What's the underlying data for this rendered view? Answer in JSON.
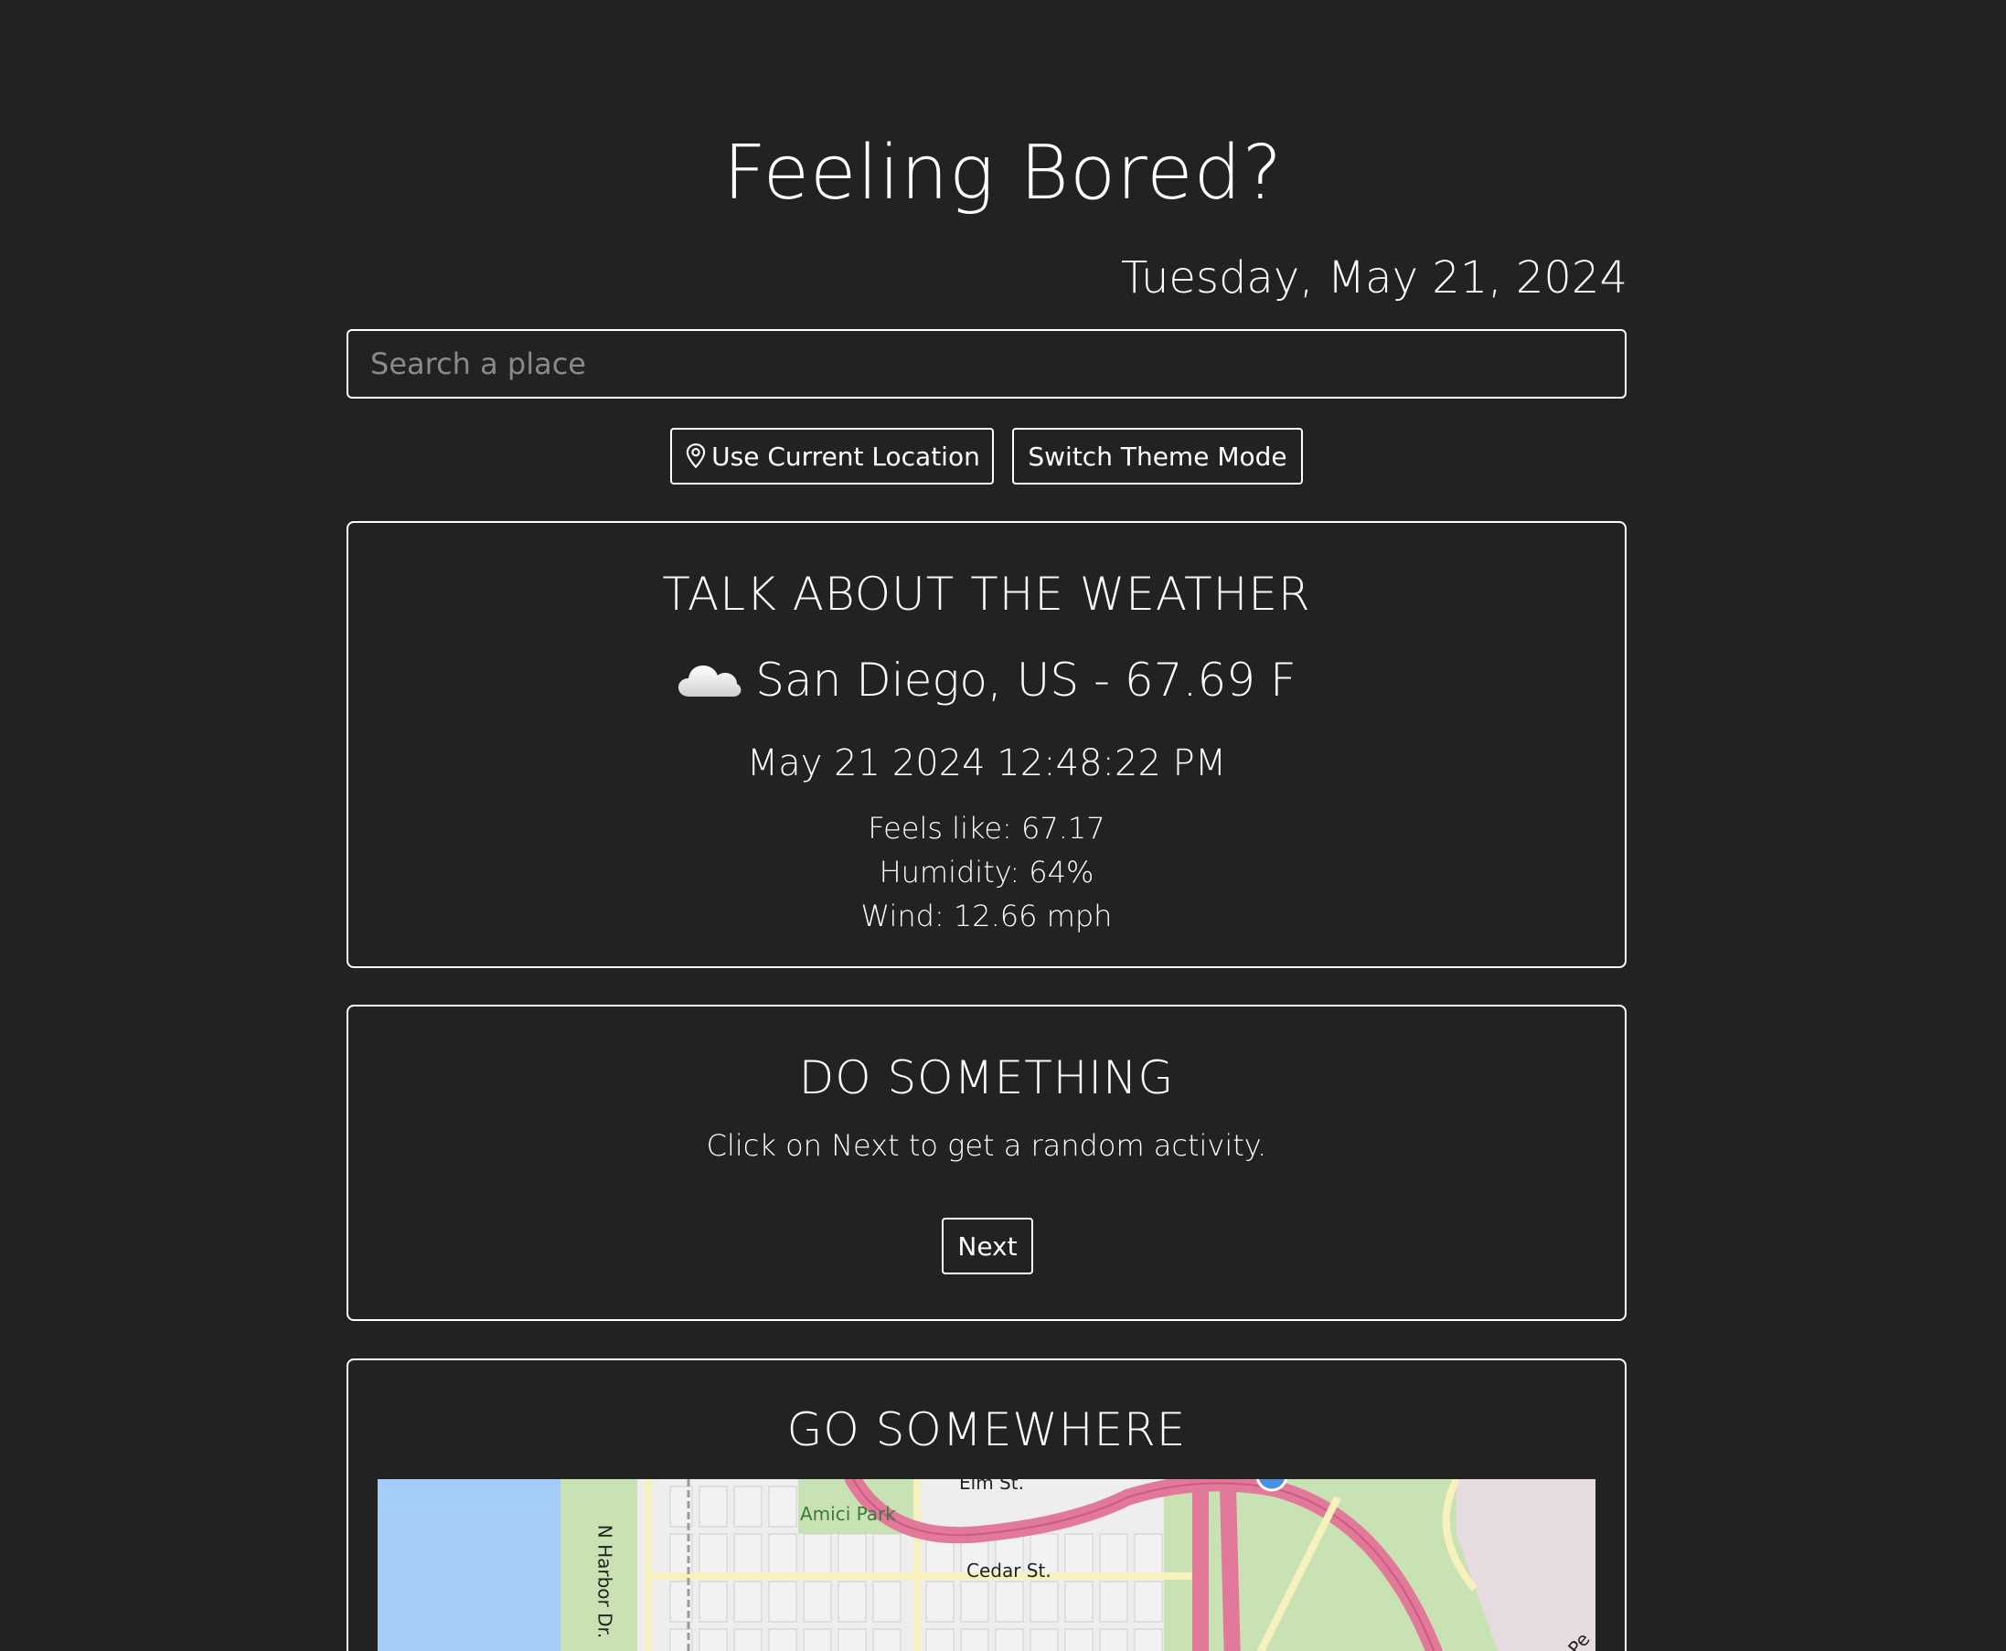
{
  "header": {
    "title": "Feeling Bored?",
    "date": "Tuesday, May 21, 2024"
  },
  "search": {
    "placeholder": "Search a place"
  },
  "buttons": {
    "use_location": "Use Current Location",
    "switch_theme": "Switch Theme Mode"
  },
  "weather": {
    "heading": "TALK ABOUT THE WEATHER",
    "icon": "cloud-icon",
    "city_line": "San Diego, US - 67.69 F",
    "datetime": "May 21 2024 12:48:22 PM",
    "feels_like": "Feels like: 67.17",
    "humidity": "Humidity: 64%",
    "wind": "Wind: 12.66 mph"
  },
  "activity": {
    "heading": "DO SOMETHING",
    "prompt": "Click on Next to get a random activity.",
    "next_label": "Next"
  },
  "go": {
    "heading": "GO SOMEWHERE",
    "map_labels": {
      "elm": "Elm St.",
      "amici": "Amici Park",
      "cedar": "Cedar St.",
      "harbor": "N Harbor Dr.",
      "pe": "Pe"
    }
  },
  "colors": {
    "background": "#222222",
    "foreground": "#ffffff",
    "placeholder": "#8a8a8a",
    "map_water": "#a3ccf7",
    "map_park": "#c9e2b3",
    "map_highway": "#e2789a"
  }
}
